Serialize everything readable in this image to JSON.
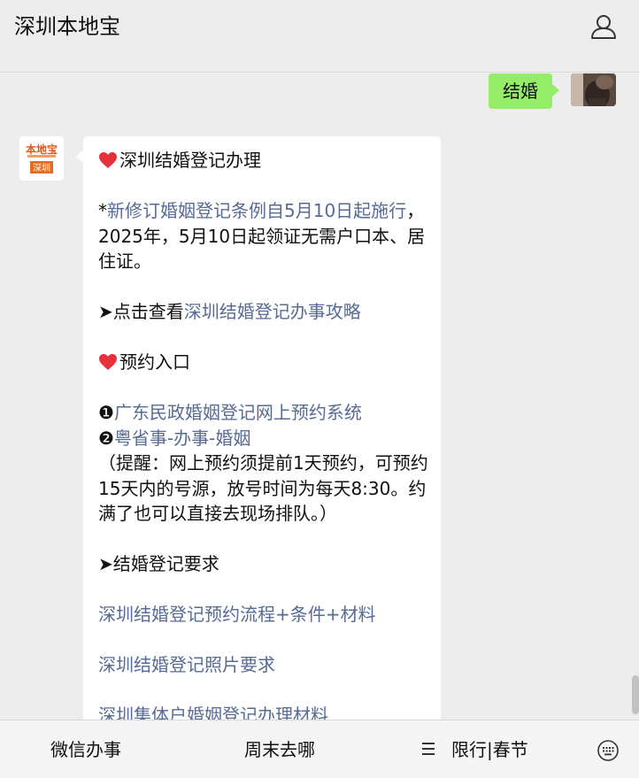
{
  "header": {
    "title": "深圳本地宝"
  },
  "me": {
    "message": "结婚"
  },
  "bot": {
    "avatar_top": "本地宝",
    "avatar_bottom": "深圳",
    "line_title": "深圳结婚登记办理",
    "notice_star": "*",
    "notice_link": "新修订婚姻登记条例自5月10日起施行",
    "notice_text": "，2025年，5月10日起领证无需户口本、居住证。",
    "guide_prefix": "➤点击查看",
    "guide_link": "深圳结婚登记办事攻略",
    "booking_title": "预约入口",
    "booking_1_num": "❶",
    "booking_1_link": "广东民政婚姻登记网上预约系统",
    "booking_2_num": "❷",
    "booking_2_link": "粤省事-办事-婚姻",
    "reminder": "（提醒：网上预约须提前1天预约，可预约15天内的号源，放号时间为每天8:30。约满了也可以直接去现场排队。）",
    "requirements_title": "➤结婚登记要求",
    "req_link_1": "深圳结婚登记预约流程+条件+材料",
    "req_link_2": "深圳结婚登记照片要求",
    "req_link_3": "深圳集体户婚姻登记办理材料"
  },
  "bottom_menu": {
    "item1": "微信办事",
    "item2": "周末去哪",
    "item3": "限行|春节"
  },
  "colors": {
    "link": "#576b95",
    "my_bubble": "#95ec69",
    "heart": "#e8303c"
  }
}
